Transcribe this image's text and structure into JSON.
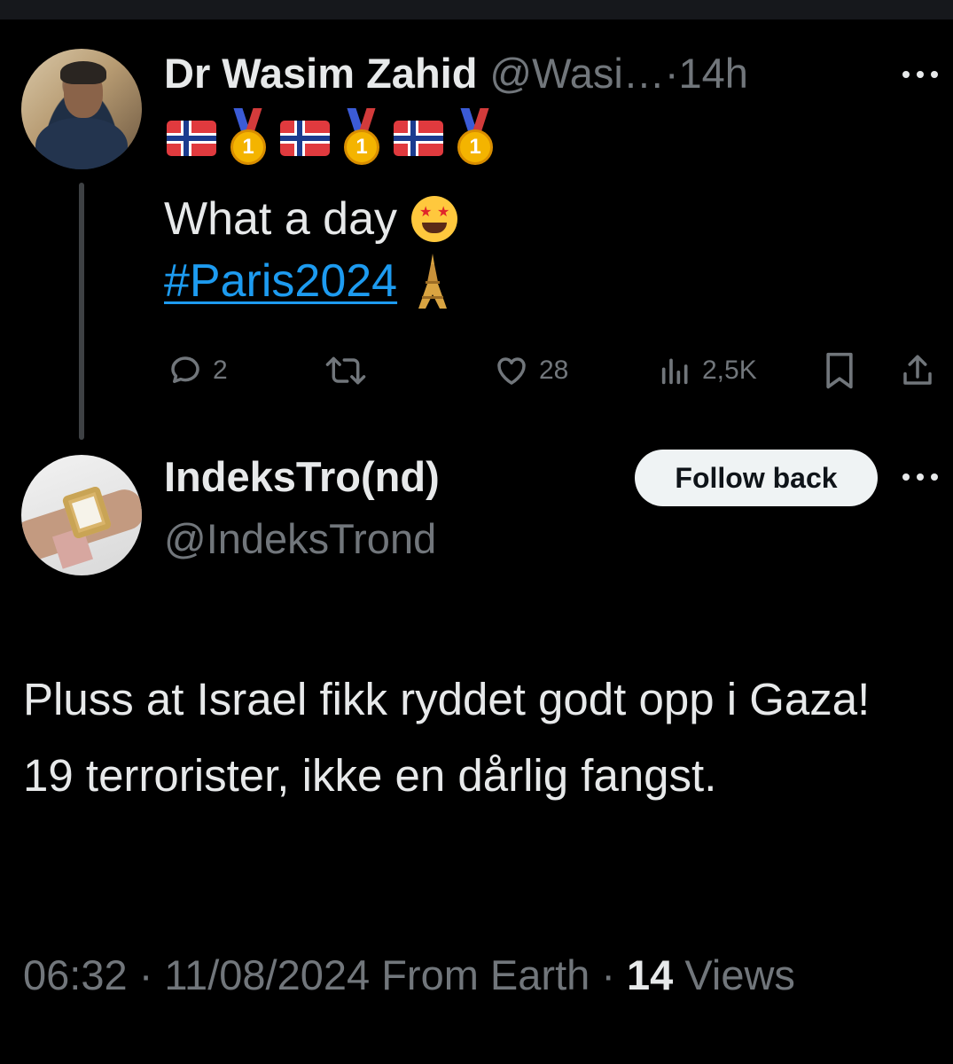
{
  "tweet1": {
    "author_name": "Dr Wasim Zahid",
    "handle": "@Wasi…",
    "separator": "·",
    "time": "14h",
    "text_line": "What a day",
    "hashtag": "#Paris2024",
    "icons": {
      "flags": [
        "norway-flag-icon",
        "norway-flag-icon",
        "norway-flag-icon"
      ],
      "medals": [
        "gold-medal-icon",
        "gold-medal-icon",
        "gold-medal-icon"
      ],
      "medal_label": "1",
      "emoji": "star-struck-icon",
      "tower": "eiffel-tower-icon"
    },
    "actions": {
      "replies": "2",
      "likes": "28",
      "views": "2,5K"
    }
  },
  "tweet2": {
    "author_name": "IndeksTro(nd)",
    "handle": "@IndeksTrond",
    "follow_label": "Follow back",
    "body": "Pluss at Israel fikk ryddet godt opp i Gaza! 19 terrorister, ikke en dårlig fangst.",
    "time": "06:32",
    "date": "11/08/2024",
    "source": "From Earth",
    "views_count": "14",
    "views_label": "Views"
  },
  "colors": {
    "background": "#000000",
    "text": "#e7e9ea",
    "muted": "#71767b",
    "link": "#1d9bf0",
    "thread_line": "#3e4144"
  }
}
